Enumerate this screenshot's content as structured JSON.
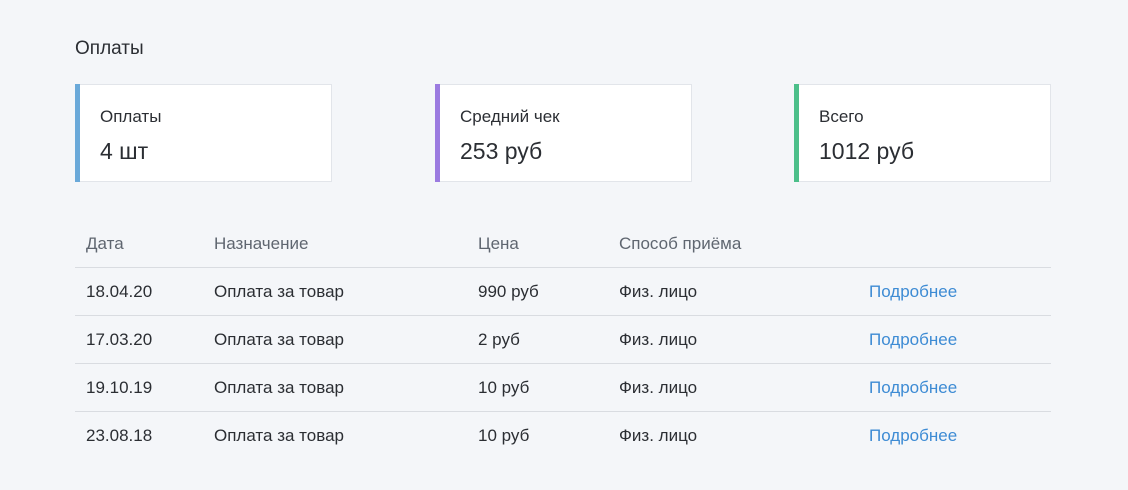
{
  "page": {
    "title": "Оплаты"
  },
  "cards": [
    {
      "label": "Оплаты",
      "value": "4 шт",
      "accent": "#6aa9d9"
    },
    {
      "label": "Средний чек",
      "value": "253 руб",
      "accent": "#9b7be0"
    },
    {
      "label": "Всего",
      "value": "1012 руб",
      "accent": "#4cbf8a"
    }
  ],
  "table": {
    "headers": {
      "date": "Дата",
      "purpose": "Назначение",
      "price": "Цена",
      "method": "Способ приёма"
    },
    "rows": [
      {
        "date": "18.04.20",
        "purpose": "Оплата за товар",
        "price": "990 руб",
        "method": "Физ. лицо",
        "link": "Подробнее"
      },
      {
        "date": "17.03.20",
        "purpose": "Оплата за товар",
        "price": "2 руб",
        "method": "Физ. лицо",
        "link": "Подробнее"
      },
      {
        "date": "19.10.19",
        "purpose": "Оплата за товар",
        "price": "10 руб",
        "method": "Физ. лицо",
        "link": "Подробнее"
      },
      {
        "date": "23.08.18",
        "purpose": "Оплата за товар",
        "price": "10 руб",
        "method": "Физ. лицо",
        "link": "Подробнее"
      }
    ]
  },
  "colors": {
    "link": "#3d8bd4",
    "background": "#f4f6f9"
  }
}
